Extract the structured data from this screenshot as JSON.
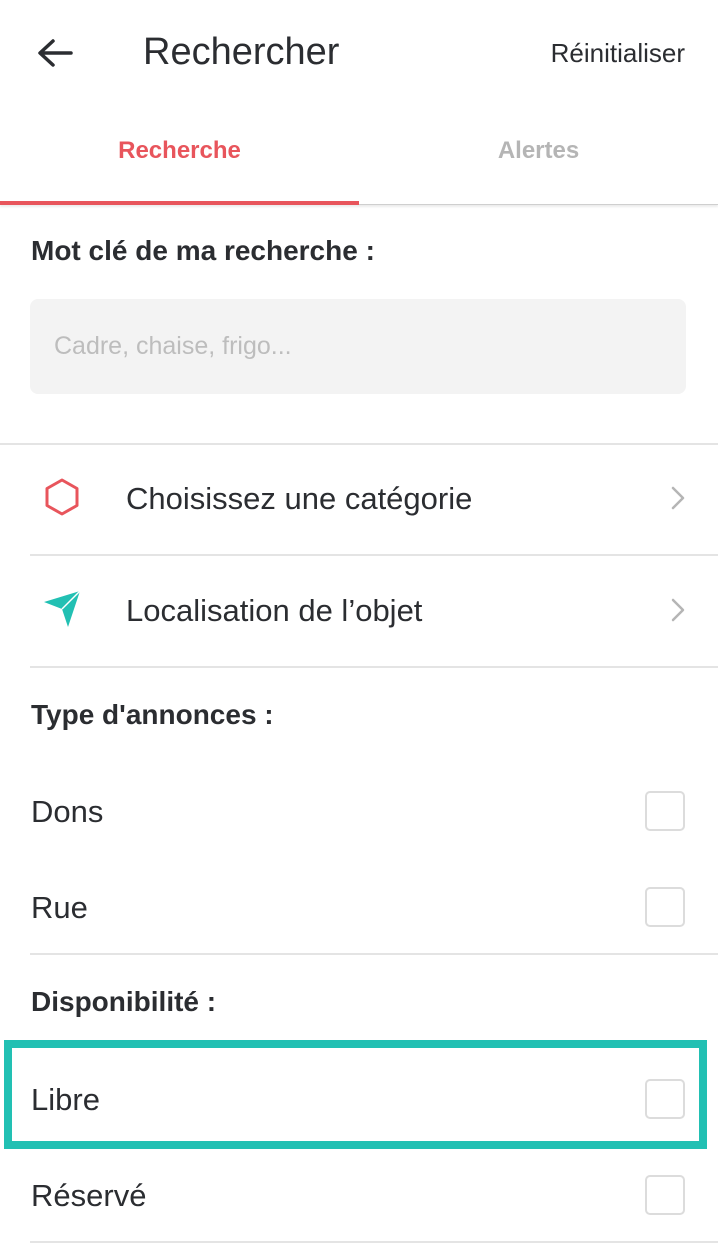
{
  "header": {
    "title": "Rechercher",
    "reset_label": "Réinitialiser"
  },
  "tabs": [
    {
      "label": "Recherche",
      "active": true
    },
    {
      "label": "Alertes",
      "active": false
    }
  ],
  "keyword": {
    "label": "Mot clé de ma recherche :",
    "value": "",
    "placeholder": "Cadre, chaise, frigo..."
  },
  "nav": {
    "category": {
      "label": "Choisissez une catégorie",
      "icon": "hexagon-icon"
    },
    "location": {
      "label": "Localisation de l’objet",
      "icon": "send-icon"
    }
  },
  "ad_type": {
    "label": "Type d'annonces :",
    "options": [
      {
        "label": "Dons",
        "checked": false
      },
      {
        "label": "Rue",
        "checked": false
      }
    ]
  },
  "availability": {
    "label": "Disponibilité :",
    "options": [
      {
        "label": "Libre",
        "checked": false,
        "highlighted": true
      },
      {
        "label": "Réservé",
        "checked": false
      }
    ]
  },
  "colors": {
    "accent": "#e8555c",
    "teal": "#22c0b3",
    "text": "#2b2d31"
  }
}
